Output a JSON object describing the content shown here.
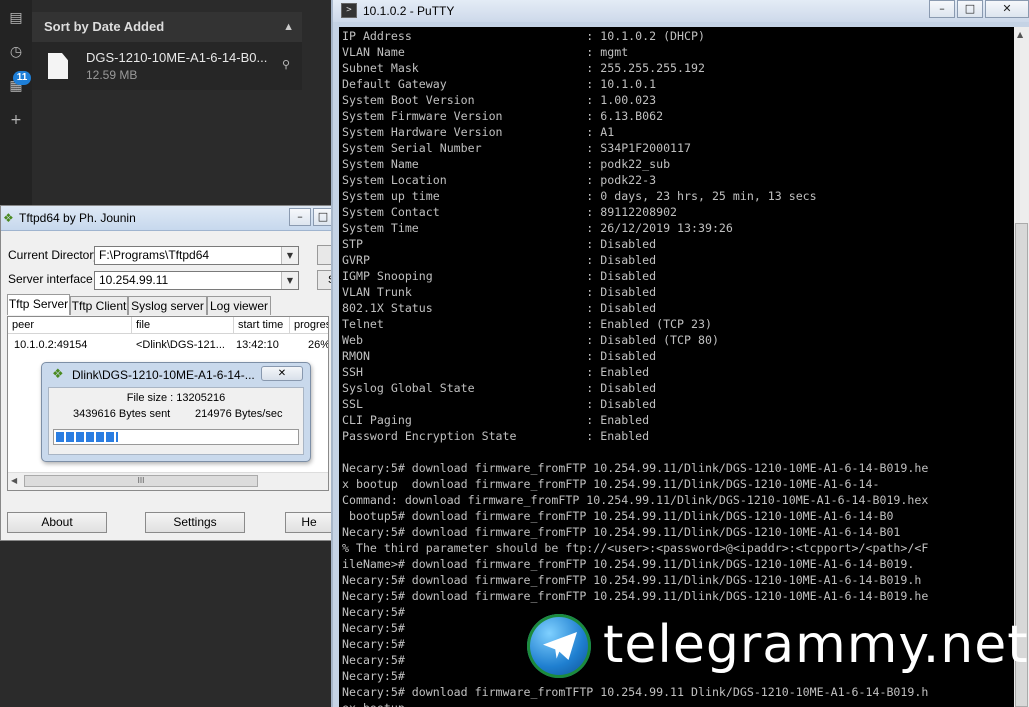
{
  "dark_panel": {
    "sort_header": "Sort by Date Added",
    "file": {
      "name": "DGS-1210-10ME-A1-6-14-B0...",
      "size": "12.59 MB"
    },
    "rail_badge": "11",
    "icons": [
      "clipboard-icon",
      "clock-icon",
      "calendar-icon",
      "plus-icon",
      "search-icon",
      "chevron-up-icon",
      "file-icon"
    ]
  },
  "tftp": {
    "title": "Tftpd64 by Ph. Jounin",
    "current_directory_label": "Current Directory",
    "current_directory": "F:\\Programs\\Tftpd64",
    "server_interface_label": "Server interface",
    "server_interface": "10.254.99.11",
    "tabs": [
      "Tftp Server",
      "Tftp Client",
      "Syslog server",
      "Log viewer"
    ],
    "columns": [
      "peer",
      "file",
      "start time",
      "progress"
    ],
    "row": {
      "peer": "10.1.0.2:49154",
      "file": "<Dlink\\DGS-121...",
      "start_time": "13:42:10",
      "progress": "26%"
    },
    "buttons": {
      "about": "About",
      "settings": "Settings",
      "help": "He"
    },
    "scroll_glyph": "III",
    "side_button_1": "",
    "side_button_2": "S"
  },
  "transfer": {
    "title": "Dlink\\DGS-1210-10ME-A1-6-14-...",
    "file_size": "File size : 13205216",
    "bytes_sent": "3439616 Bytes sent",
    "rate": "214976 Bytes/sec",
    "progress": 0.26
  },
  "putty": {
    "title": "10.1.0.2 - PuTTY",
    "lines": [
      "IP Address                         : 10.1.0.2 (DHCP)",
      "VLAN Name                          : mgmt",
      "Subnet Mask                        : 255.255.255.192",
      "Default Gateway                    : 10.1.0.1",
      "System Boot Version                : 1.00.023",
      "System Firmware Version            : 6.13.B062",
      "System Hardware Version            : A1",
      "System Serial Number               : S34P1F2000117",
      "System Name                        : podk22_sub",
      "System Location                    : podk22-3",
      "System up time                     : 0 days, 23 hrs, 25 min, 13 secs",
      "System Contact                     : 89112208902",
      "System Time                        : 26/12/2019 13:39:26",
      "STP                                : Disabled",
      "GVRP                               : Disabled",
      "IGMP Snooping                      : Disabled",
      "VLAN Trunk                         : Disabled",
      "802.1X Status                      : Disabled",
      "Telnet                             : Enabled (TCP 23)",
      "Web                                : Disabled (TCP 80)",
      "RMON                               : Disabled",
      "SSH                                : Enabled",
      "Syslog Global State                : Disabled",
      "SSL                                : Disabled",
      "CLI Paging                         : Enabled",
      "Password Encryption State          : Enabled",
      "",
      "Necary:5# download firmware_fromFTP 10.254.99.11/Dlink/DGS-1210-10ME-A1-6-14-B019.he",
      "x bootup  download firmware_fromFTP 10.254.99.11/Dlink/DGS-1210-10ME-A1-6-14-",
      "Command: download firmware_fromFTP 10.254.99.11/Dlink/DGS-1210-10ME-A1-6-14-B019.hex",
      " bootup5# download firmware_fromFTP 10.254.99.11/Dlink/DGS-1210-10ME-A1-6-14-B0",
      "Necary:5# download firmware_fromFTP 10.254.99.11/Dlink/DGS-1210-10ME-A1-6-14-B01",
      "% The third parameter should be ftp://<user>:<password>@<ipaddr>:<tcpport>/<path>/<F",
      "ileName># download firmware_fromFTP 10.254.99.11/Dlink/DGS-1210-10ME-A1-6-14-B019.",
      "Necary:5# download firmware_fromFTP 10.254.99.11/Dlink/DGS-1210-10ME-A1-6-14-B019.h",
      "Necary:5# download firmware_fromFTP 10.254.99.11/Dlink/DGS-1210-10ME-A1-6-14-B019.he",
      "Necary:5#",
      "Necary:5#",
      "Necary:5#",
      "Necary:5#",
      "Necary:5#",
      "Necary:5# download firmware_fromTFTP 10.254.99.11 Dlink/DGS-1210-10ME-A1-6-14-B019.h",
      "ex bootup"
    ]
  },
  "watermark": {
    "text": "telegrammy.net"
  }
}
